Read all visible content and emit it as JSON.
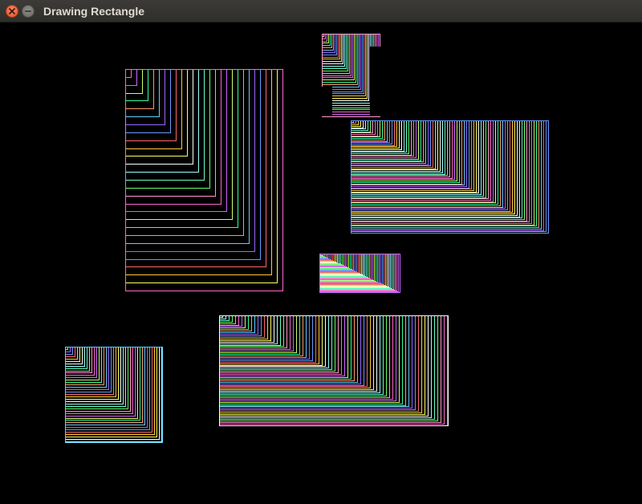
{
  "window": {
    "title": "Drawing Rectangle",
    "close_icon": "close-icon",
    "minimize_icon": "minimize-icon"
  },
  "colors": {
    "background": "#000000",
    "titlebar": "#3c3b37",
    "title_text": "#dfdbd2",
    "close_button": "#e95420",
    "palette": [
      "#ff66cc",
      "#66ffcc",
      "#ffff66",
      "#6699ff",
      "#ff9966",
      "#cc66ff",
      "#66ff66",
      "#ffffff",
      "#ff6666",
      "#66ccff",
      "#ccff66",
      "#ff99cc",
      "#99ffff",
      "#ffcc33",
      "#9966ff",
      "#33ff99"
    ]
  }
}
